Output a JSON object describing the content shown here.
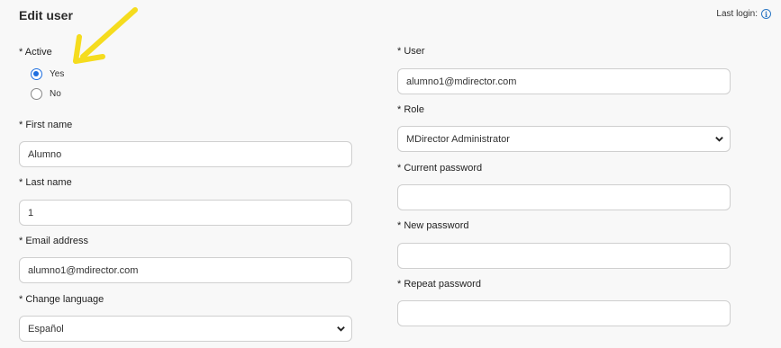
{
  "header": {
    "title": "Edit user",
    "last_login_label": "Last login:",
    "info_icon": "info-circle-icon"
  },
  "active": {
    "label": "* Active",
    "options": [
      {
        "label": "Yes",
        "checked": true
      },
      {
        "label": "No",
        "checked": false
      }
    ]
  },
  "first_name": {
    "label": "* First name",
    "value": "Alumno"
  },
  "last_name": {
    "label": "* Last name",
    "value": "1"
  },
  "email": {
    "label": "* Email address",
    "value": "alumno1@mdirector.com"
  },
  "language": {
    "label": "* Change language",
    "value": "Español"
  },
  "user": {
    "label": "* User",
    "value": "alumno1@mdirector.com"
  },
  "role": {
    "label": "* Role",
    "value": "MDirector Administrator"
  },
  "current_password": {
    "label": "* Current password",
    "value": ""
  },
  "new_password": {
    "label": "* New password",
    "value": ""
  },
  "repeat_password": {
    "label": "* Repeat password",
    "value": ""
  },
  "colors": {
    "accent": "#1f6fe0",
    "annotation_arrow": "#f5dc1e",
    "info": "#2b78c5"
  }
}
